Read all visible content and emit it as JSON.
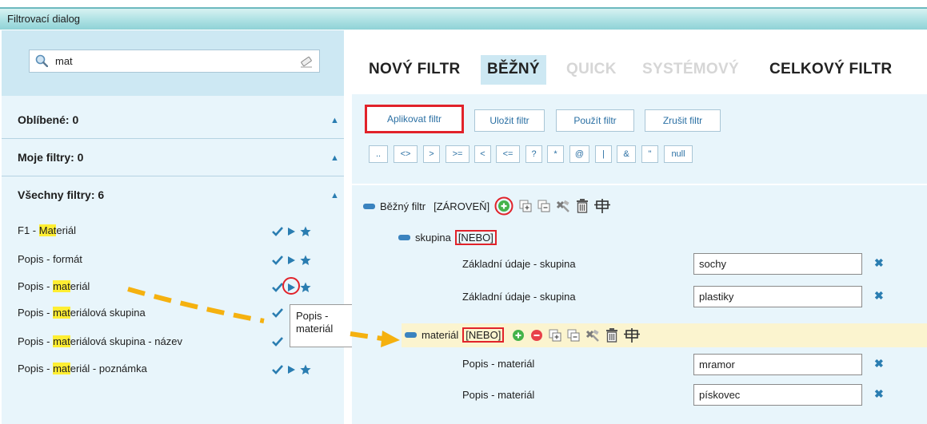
{
  "window": {
    "title": "Filtrovací dialog"
  },
  "search": {
    "value": "mat"
  },
  "sections": {
    "favorites": "Oblíbené: 0",
    "mine": "Moje filtry: 0",
    "all": "Všechny filtry: 6"
  },
  "filters": [
    {
      "pre": "F1 - ",
      "hl": "Mat",
      "post": "eriál"
    },
    {
      "pre": "Popis - formát",
      "hl": "",
      "post": ""
    },
    {
      "pre": "Popis - ",
      "hl": "mat",
      "post": "eriál"
    },
    {
      "pre": "Popis - ",
      "hl": "mat",
      "post": "eriálová skupina"
    },
    {
      "pre": "Popis - ",
      "hl": "mat",
      "post": "eriálová skupina - název"
    },
    {
      "pre": "Popis - ",
      "hl": "mat",
      "post": "eriál - poznámka"
    }
  ],
  "tooltip": {
    "line1": "Popis -",
    "line2": "materiál"
  },
  "tabs": {
    "new": "NOVÝ FILTR",
    "current": "BĚŽNÝ",
    "quick": "QUICK",
    "system": "SYSTÉMOVÝ",
    "total": "CELKOVÝ FILTR"
  },
  "actions": {
    "apply": "Aplikovat filtr",
    "save": "Uložit filtr",
    "use": "Použít filtr",
    "cancel": "Zrušit filtr"
  },
  "operators": [
    "..",
    "<>",
    ">",
    ">=",
    "<",
    "<=",
    "?",
    "*",
    "@",
    "|",
    "&",
    "\"",
    "null"
  ],
  "tree": {
    "root_label": "Běžný filtr",
    "root_op": "[ZÁROVEŇ]",
    "group1_label": "skupina",
    "group1_op": "[NEBO]",
    "group1_fields": [
      {
        "label": "Základní údaje - skupina",
        "value": "sochy"
      },
      {
        "label": "Základní údaje - skupina",
        "value": "plastiky"
      }
    ],
    "group2_label": "materiál",
    "group2_op": "[NEBO]",
    "group2_fields": [
      {
        "label": "Popis - materiál",
        "value": "mramor"
      },
      {
        "label": "Popis - materiál",
        "value": "pískovec"
      }
    ]
  },
  "colors": {
    "accent": "#2a7db1",
    "highlight": "#ffee33",
    "annotation_red": "#e1222a",
    "arrow": "#f5b10f"
  }
}
